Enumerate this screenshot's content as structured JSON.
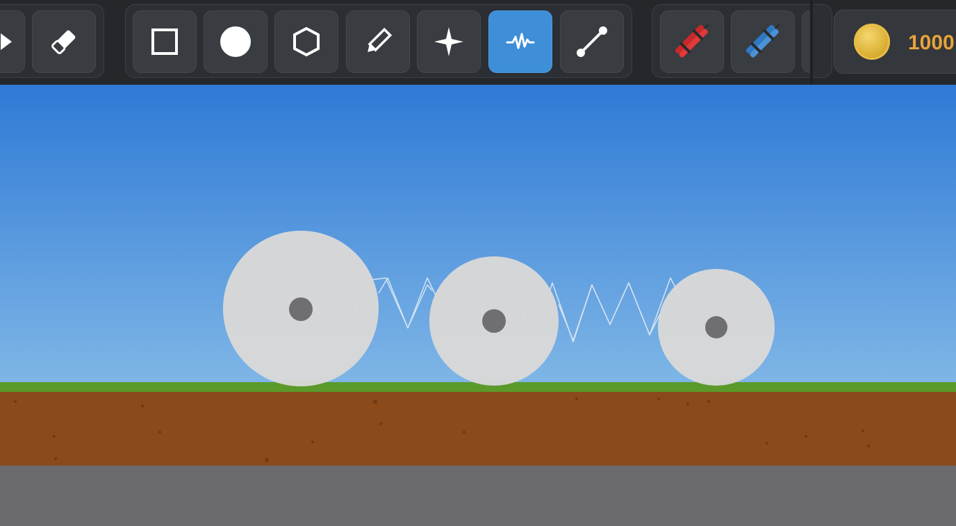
{
  "toolbar": {
    "tools": [
      {
        "id": "select",
        "icon": "cursor-arrow-icon",
        "active": false
      },
      {
        "id": "eraser",
        "icon": "eraser-icon",
        "active": false
      },
      {
        "id": "box",
        "icon": "square-icon",
        "active": false
      },
      {
        "id": "circle",
        "icon": "circle-icon",
        "active": false
      },
      {
        "id": "polygon",
        "icon": "hexagon-icon",
        "active": false
      },
      {
        "id": "draw",
        "icon": "pencil-icon",
        "active": false
      },
      {
        "id": "fixed-joint",
        "icon": "sparkle-icon",
        "active": false
      },
      {
        "id": "spring",
        "icon": "spring-wave-icon",
        "active": true
      },
      {
        "id": "rope",
        "icon": "rod-link-icon",
        "active": false
      },
      {
        "id": "red-dynamite",
        "icon": "red-dynamite-icon",
        "active": false
      },
      {
        "id": "blue-dynamite",
        "icon": "blue-dynamite-icon",
        "active": false
      }
    ],
    "accent_color": "#3e8ed8"
  },
  "coins": {
    "icon": "gold-coin-icon",
    "amount": "1000"
  },
  "scene": {
    "sky_top_color": "#2f7ad6",
    "sky_bottom_color": "#7fb6e6",
    "grass_color": "#5b9a2a",
    "dirt_color": "#8a4a1a",
    "floor_color": "#6b6b6d",
    "wheel_color": "#d8d8d8",
    "hub_color": "#6f6f71",
    "objects": [
      "wheel",
      "spring",
      "wheel",
      "spring",
      "wheel"
    ]
  }
}
